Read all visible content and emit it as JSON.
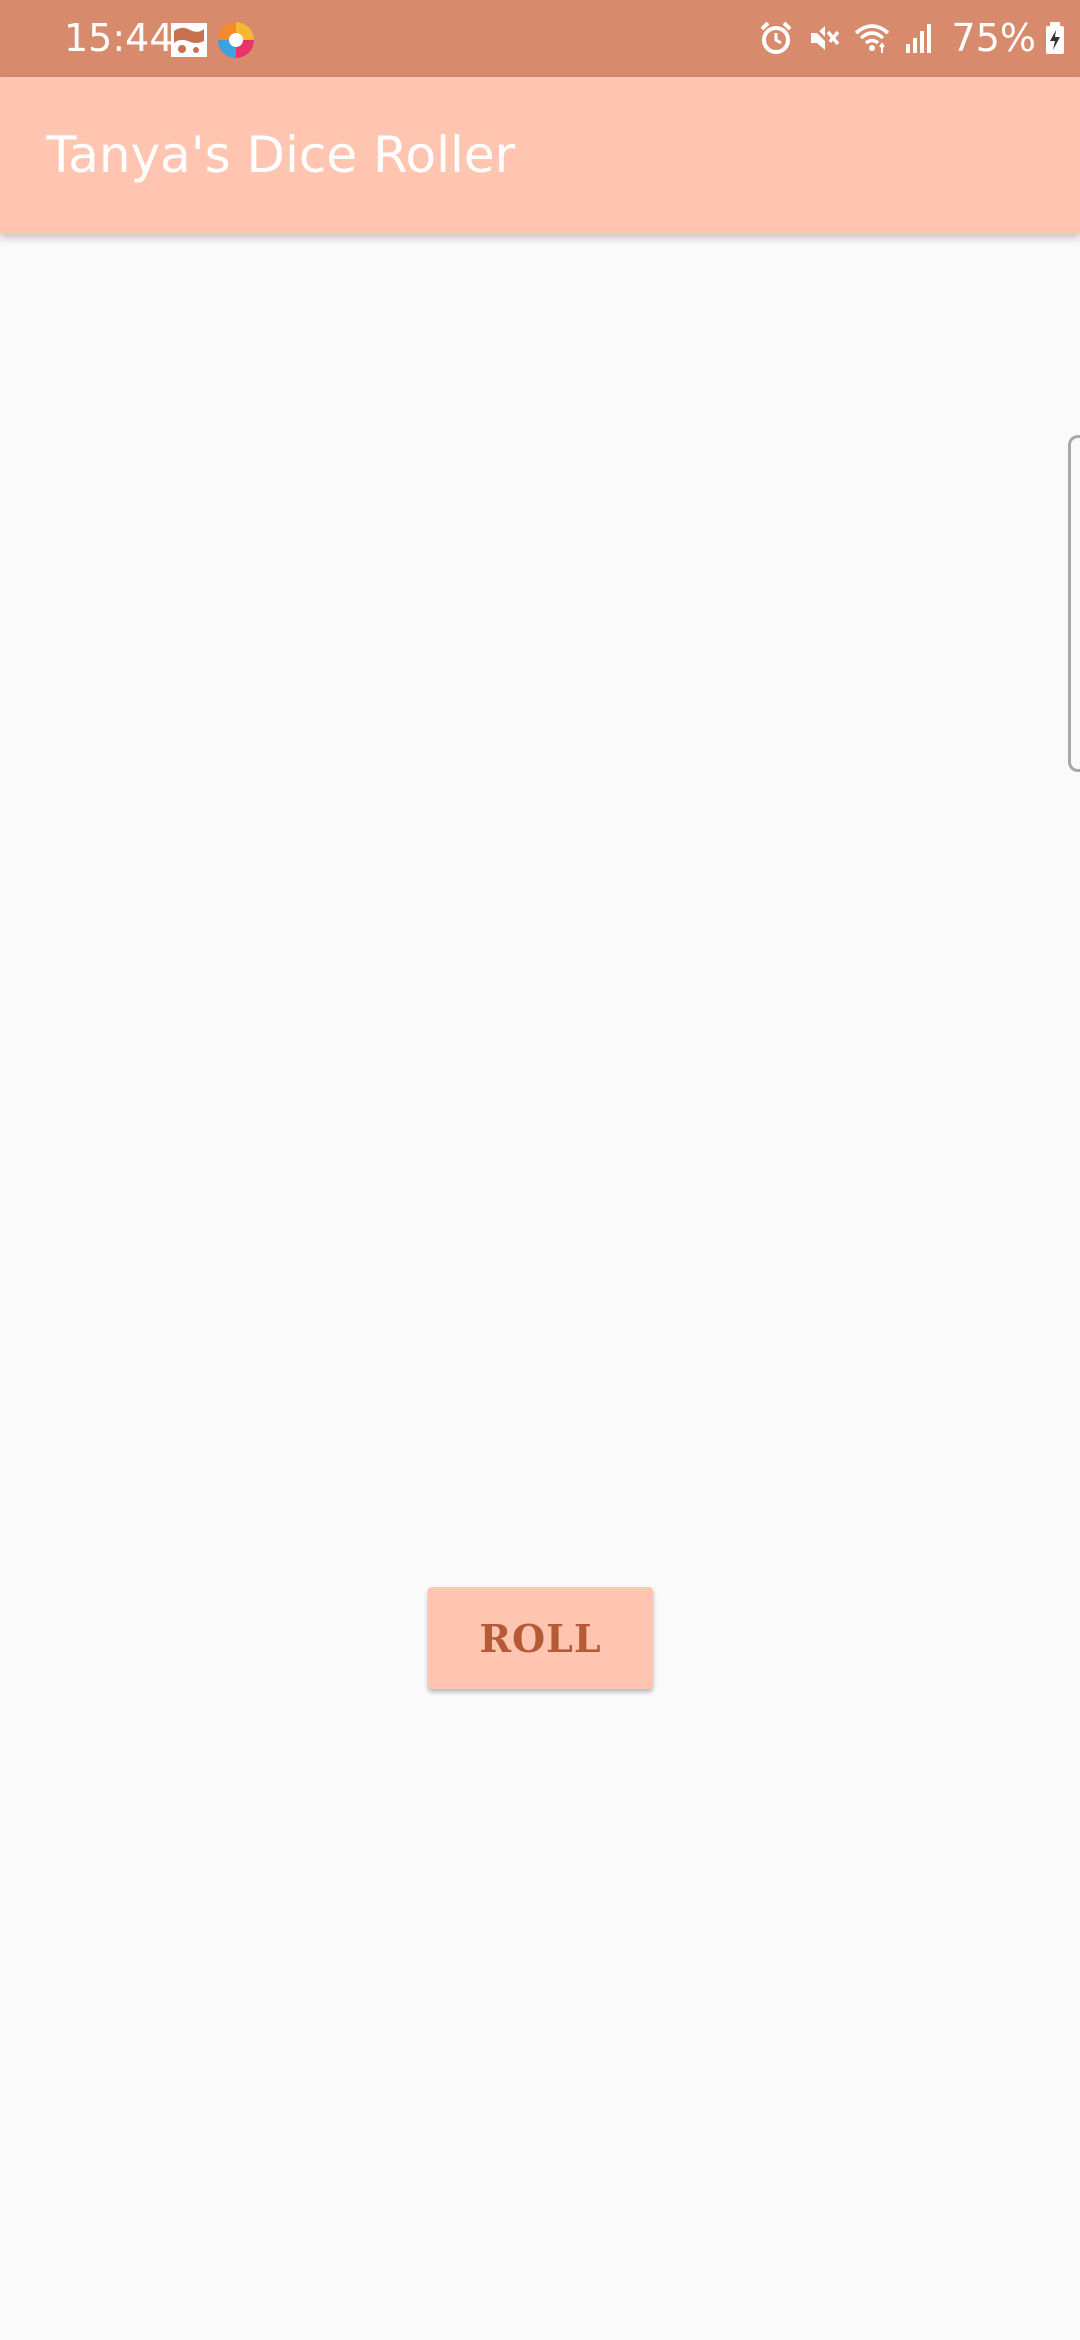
{
  "status_bar": {
    "time": "15:44",
    "battery_percent": "75%",
    "background_color": "#d88b6c",
    "left_icons": [
      "photo-notification-icon",
      "colorful-app-notification-icon"
    ],
    "right_icons": [
      "alarm-icon",
      "mute-icon",
      "wifi-icon",
      "signal-icon",
      "battery-charging-icon"
    ]
  },
  "app_bar": {
    "title": "Tanya's Dice Roller",
    "background_color": "#ffc5b0"
  },
  "main": {
    "roll_button_label": "ROLL",
    "button_text_color": "#b45a36"
  }
}
